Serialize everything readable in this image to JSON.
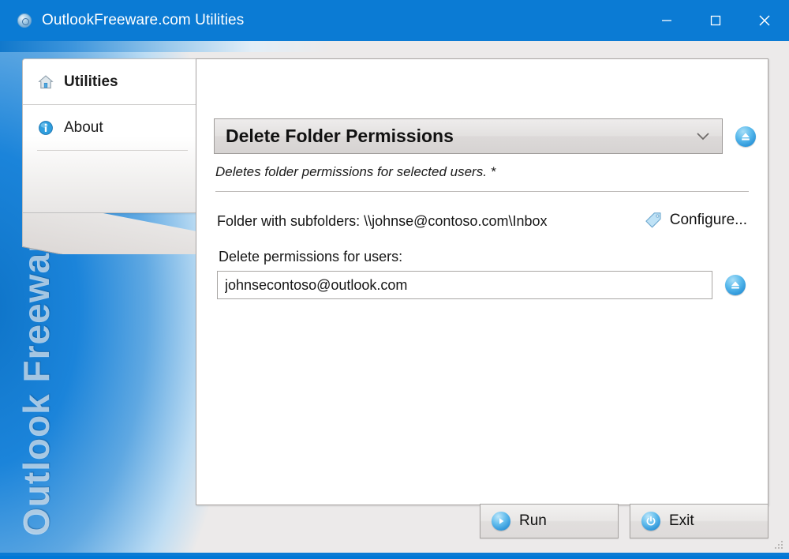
{
  "window": {
    "title": "OutlookFreeware.com Utilities",
    "app_icon": "app-globe-icon",
    "minimize_icon": "minimize-icon",
    "maximize_icon": "maximize-icon",
    "close_icon": "close-icon",
    "accent_color": "#0b7bd4",
    "client_background": "#eceaea"
  },
  "watermark": {
    "text": "Outlook Freeware .com"
  },
  "sidebar": {
    "items": [
      {
        "label": "Utilities",
        "icon": "home-icon",
        "active": true
      },
      {
        "label": "About",
        "icon": "info-icon",
        "active": false
      }
    ]
  },
  "main": {
    "utility_select": {
      "value": "Delete Folder Permissions",
      "chevron_icon": "chevron-down-icon",
      "eject_button_icon": "eject-icon"
    },
    "description": "Deletes folder permissions for selected users. *",
    "folder_row": {
      "label": "Folder with subfolders: \\\\johnse@contoso.com\\Inbox",
      "configure_label": "Configure...",
      "configure_icon": "tag-icon"
    },
    "users_field": {
      "label": "Delete permissions for users:",
      "value": "johnsecontoso@outlook.com",
      "placeholder": "",
      "eject_button_icon": "eject-icon"
    }
  },
  "footer": {
    "run_label": "Run",
    "run_icon": "play-icon",
    "exit_label": "Exit",
    "exit_icon": "power-icon",
    "resize_grip_icon": "resize-grip-icon"
  }
}
